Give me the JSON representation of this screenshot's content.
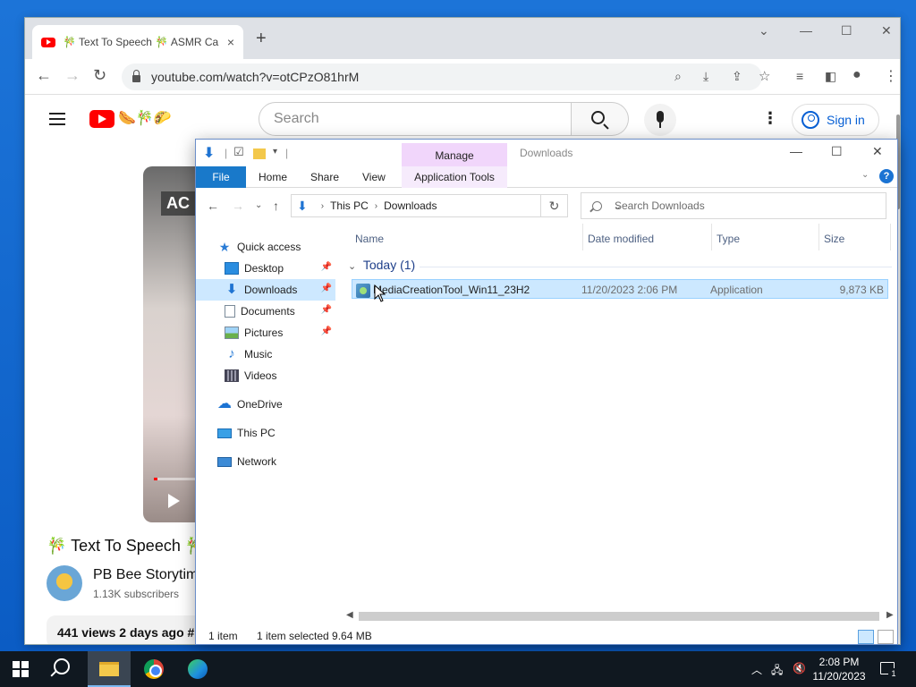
{
  "chrome": {
    "tab_title": "🎋 Text To Speech 🎋 ASMR Ca",
    "tab_close": "×",
    "new_tab": "+",
    "url": "youtube.com/watch?v=otCPzO81hrM"
  },
  "youtube": {
    "search_placeholder": "Search",
    "signin": "Sign in",
    "video_overlay": "AC",
    "title": "🎋 Text To Speech 🎋",
    "channel_name": "PB Bee Storytim",
    "subscribers": "1.13K subscribers",
    "description": "441 views  2 days ago  #"
  },
  "explorer": {
    "window_title": "Downloads",
    "manage_tab": "Manage",
    "ribbon_tabs": {
      "file": "File",
      "home": "Home",
      "share": "Share",
      "view": "View",
      "app_tools": "Application Tools"
    },
    "help": "?",
    "address": {
      "this_pc": "This PC",
      "downloads": "Downloads"
    },
    "search_placeholder": "Search Downloads",
    "nav": {
      "quick_access": "Quick access",
      "desktop": "Desktop",
      "downloads": "Downloads",
      "documents": "Documents",
      "pictures": "Pictures",
      "music": "Music",
      "videos": "Videos",
      "onedrive": "OneDrive",
      "this_pc": "This PC",
      "network": "Network"
    },
    "columns": {
      "name": "Name",
      "date": "Date modified",
      "type": "Type",
      "size": "Size"
    },
    "group": "Today (1)",
    "file": {
      "name": "MediaCreationTool_Win11_23H2",
      "date": "11/20/2023 2:06 PM",
      "type": "Application",
      "size": "9,873 KB"
    },
    "status": {
      "count": "1 item",
      "selected": "1 item selected  9.64 MB"
    }
  },
  "taskbar": {
    "time": "2:08 PM",
    "date": "11/20/2023",
    "notifications": "1"
  },
  "colors": {
    "file_tab": "#1979ca",
    "manage_tab": "#f1d6fb",
    "selection": "#cce8ff",
    "youtube_red": "#ff0000"
  }
}
